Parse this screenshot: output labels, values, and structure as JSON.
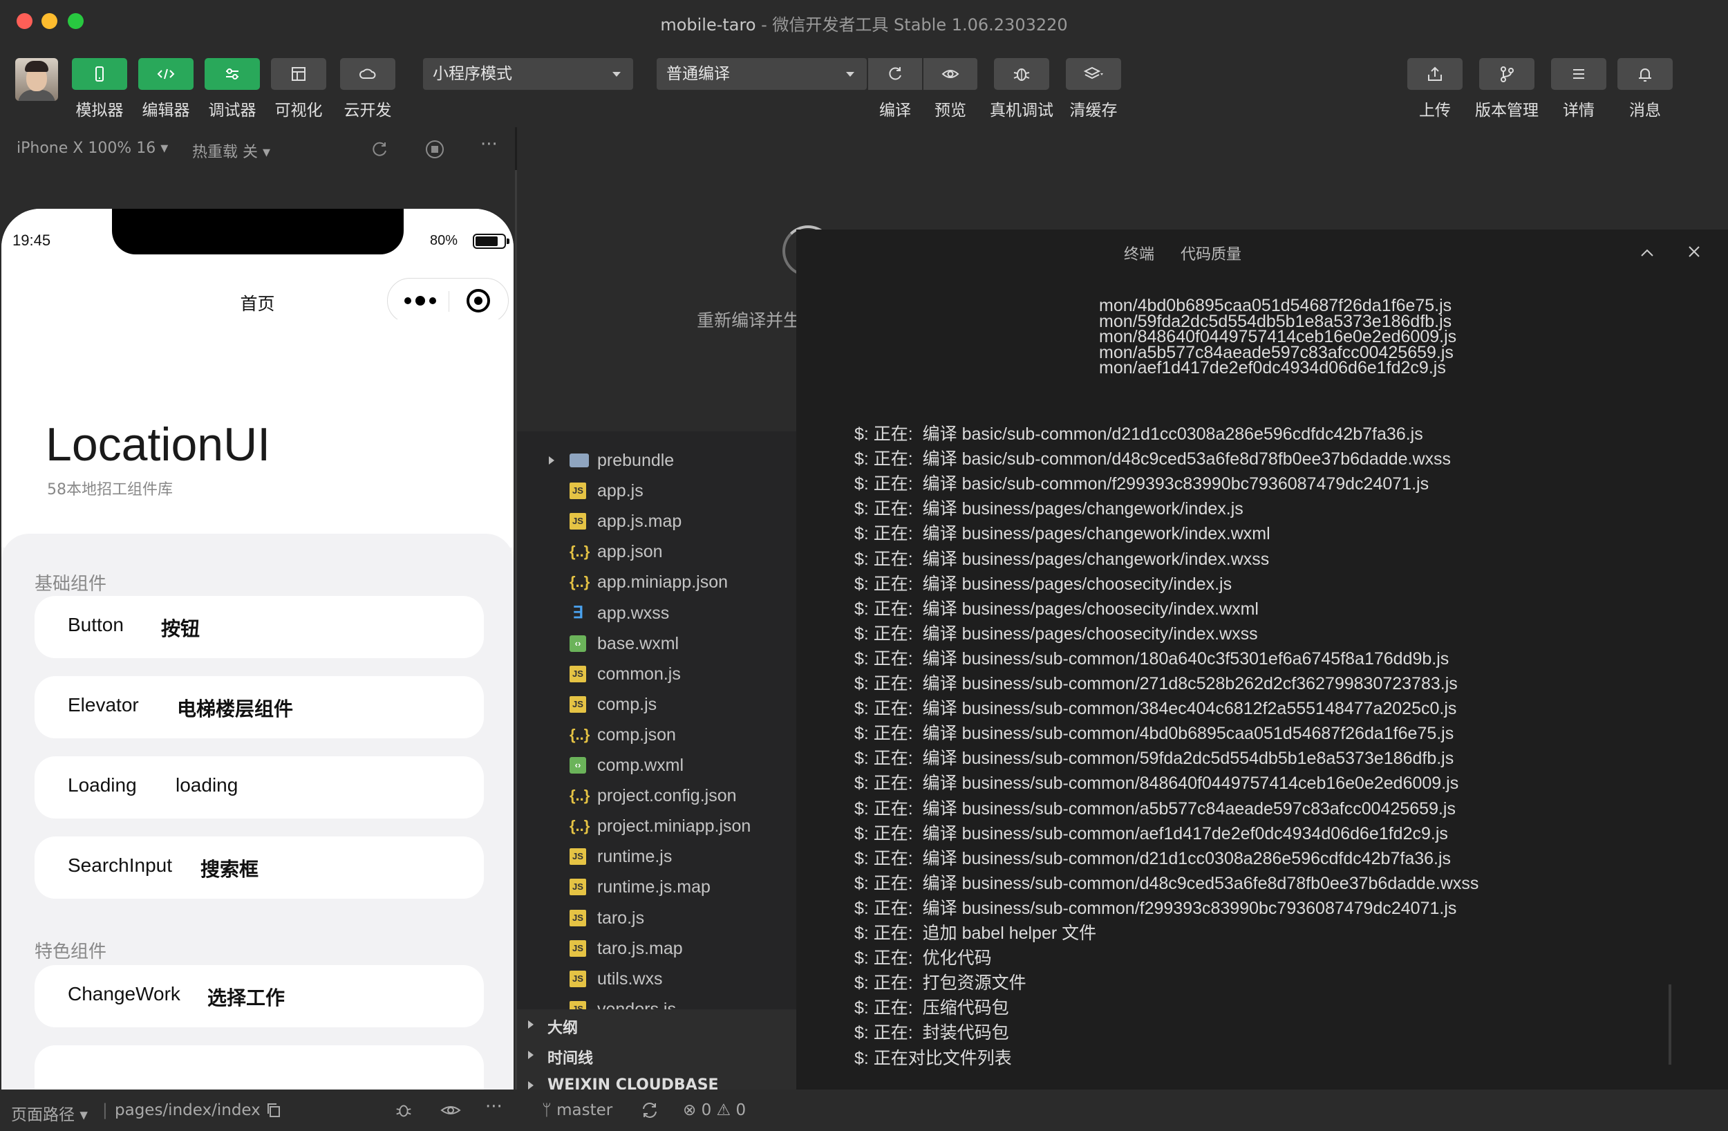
{
  "window": {
    "title_app": "mobile-taro",
    "title_rest": " -  微信开发者工具 Stable 1.06.2303220"
  },
  "toolbar": {
    "simulator_label": "模拟器",
    "editor_label": "编辑器",
    "debugger_label": "调试器",
    "visual_label": "可视化",
    "cloud_label": "云开发",
    "mode_select": "小程序模式",
    "compile_select": "普通编译",
    "compile_label": "编译",
    "preview_label": "预览",
    "remote_debug_label": "真机调试",
    "clear_cache_label": "清缓存",
    "upload_label": "上传",
    "version_label": "版本管理",
    "details_label": "详情",
    "messages_label": "消息"
  },
  "simulator": {
    "device": "iPhone X 100% 16",
    "hot_reload": "热重载 关",
    "status_time": "19:45",
    "battery_text": "80%",
    "battery_level": 0.8,
    "nav_title": "首页"
  },
  "app_page": {
    "title": "LocationUI",
    "subtitle": "58本地招工组件库",
    "section_basic": "基础组件",
    "section_feature": "特色组件",
    "cards": [
      {
        "en": "Button",
        "cn": "按钮"
      },
      {
        "en": "Elevator",
        "cn": "电梯楼层组件"
      },
      {
        "en": "Loading",
        "cn": "loading"
      },
      {
        "en": "SearchInput",
        "cn": "搜索框"
      },
      {
        "en": "ChangeWork",
        "cn": "选择工作"
      }
    ]
  },
  "loading": {
    "text": "重新编译并生成应用预览版..."
  },
  "terminal": {
    "tab_terminal": "终端",
    "tab_quality": "代码质量",
    "cut_lines": [
      "mon/4bd0b6895caa051d54687f26da1f6e75.js",
      "mon/59fda2dc5d554db5b1e8a5373e186dfb.js",
      "mon/848640f0449757414ceb16e0e2ed6009.js",
      "mon/a5b577c84aeade597c83afcc00425659.js",
      "mon/aef1d417de2ef0dc4934d06d6e1fd2c9.js"
    ],
    "lines": [
      "$: 正在:  编译 basic/sub-common/d21d1cc0308a286e596cdfdc42b7fa36.js",
      "$: 正在:  编译 basic/sub-common/d48c9ced53a6fe8d78fb0ee37b6dadde.wxss",
      "$: 正在:  编译 basic/sub-common/f299393c83990bc7936087479dc24071.js",
      "$: 正在:  编译 business/pages/changework/index.js",
      "$: 正在:  编译 business/pages/changework/index.wxml",
      "$: 正在:  编译 business/pages/changework/index.wxss",
      "$: 正在:  编译 business/pages/choosecity/index.js",
      "$: 正在:  编译 business/pages/choosecity/index.wxml",
      "$: 正在:  编译 business/pages/choosecity/index.wxss",
      "$: 正在:  编译 business/sub-common/180a640c3f5301ef6a6745f8a176dd9b.js",
      "$: 正在:  编译 business/sub-common/271d8c528b262d2cf362799830723783.js",
      "$: 正在:  编译 business/sub-common/384ec404c6812f2a555148477a2025c0.js",
      "$: 正在:  编译 business/sub-common/4bd0b6895caa051d54687f26da1f6e75.js",
      "$: 正在:  编译 business/sub-common/59fda2dc5d554db5b1e8a5373e186dfb.js",
      "$: 正在:  编译 business/sub-common/848640f0449757414ceb16e0e2ed6009.js",
      "$: 正在:  编译 business/sub-common/a5b577c84aeade597c83afcc00425659.js",
      "$: 正在:  编译 business/sub-common/aef1d417de2ef0dc4934d06d6e1fd2c9.js",
      "$: 正在:  编译 business/sub-common/d21d1cc0308a286e596cdfdc42b7fa36.js",
      "$: 正在:  编译 business/sub-common/d48c9ced53a6fe8d78fb0ee37b6dadde.wxss",
      "$: 正在:  编译 business/sub-common/f299393c83990bc7936087479dc24071.js",
      "$: 正在:  追加 babel helper 文件",
      "$: 正在:  优化代码",
      "$: 正在:  打包资源文件",
      "$: 正在:  压缩代码包",
      "$: 正在:  封装代码包",
      "$: 正在对比文件列表"
    ]
  },
  "filetree": {
    "files": [
      {
        "name": "prebundle",
        "icon": "folder"
      },
      {
        "name": "app.js",
        "icon": "js"
      },
      {
        "name": "app.js.map",
        "icon": "map"
      },
      {
        "name": "app.json",
        "icon": "json"
      },
      {
        "name": "app.miniapp.json",
        "icon": "json"
      },
      {
        "name": "app.wxss",
        "icon": "css"
      },
      {
        "name": "base.wxml",
        "icon": "wxml"
      },
      {
        "name": "common.js",
        "icon": "js"
      },
      {
        "name": "comp.js",
        "icon": "js"
      },
      {
        "name": "comp.json",
        "icon": "json"
      },
      {
        "name": "comp.wxml",
        "icon": "wxml"
      },
      {
        "name": "project.config.json",
        "icon": "json"
      },
      {
        "name": "project.miniapp.json",
        "icon": "json"
      },
      {
        "name": "runtime.js",
        "icon": "js"
      },
      {
        "name": "runtime.js.map",
        "icon": "map"
      },
      {
        "name": "taro.js",
        "icon": "js"
      },
      {
        "name": "taro.js.map",
        "icon": "map"
      },
      {
        "name": "utils.wxs",
        "icon": "js"
      },
      {
        "name": "vendors.js",
        "icon": "js"
      }
    ],
    "outline": "大纲",
    "timeline": "时间线",
    "cloudbase": "WEIXIN CLOUDBASE CONTAI..."
  },
  "bottombar": {
    "page_path_label": "页面路径",
    "page_path": "pages/index/index",
    "branch": "master",
    "errors": "0",
    "warnings": "0"
  },
  "colors": {
    "accent_green": "#29a85a",
    "traffic_close": "#ff5f57",
    "traffic_min": "#febc2e",
    "traffic_max": "#28c840"
  }
}
